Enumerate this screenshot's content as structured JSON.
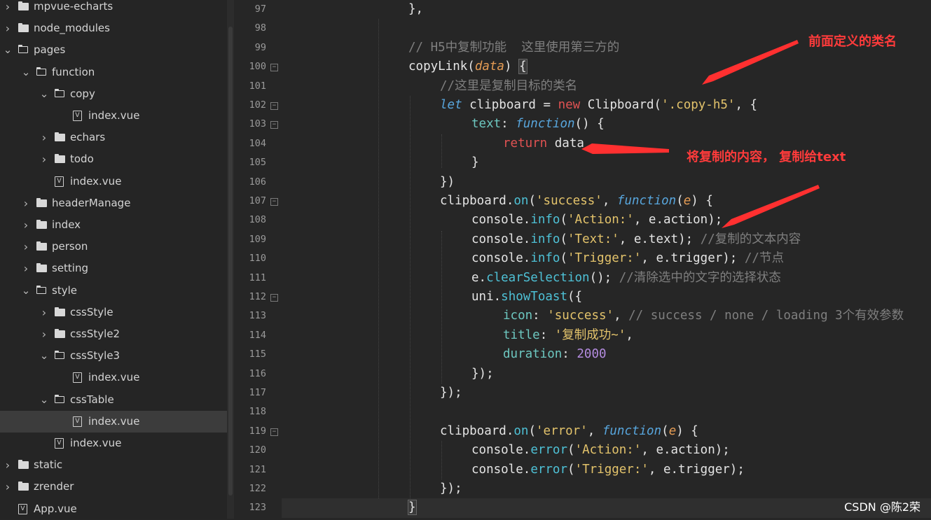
{
  "file_tree": [
    {
      "label": "mpvue-echarts",
      "type": "folder",
      "state": "collapsed",
      "depth": 0
    },
    {
      "label": "node_modules",
      "type": "folder",
      "state": "collapsed",
      "depth": 0
    },
    {
      "label": "pages",
      "type": "folder",
      "state": "expanded",
      "depth": 0
    },
    {
      "label": "function",
      "type": "folder",
      "state": "expanded",
      "depth": 1
    },
    {
      "label": "copy",
      "type": "folder",
      "state": "expanded",
      "depth": 2
    },
    {
      "label": "index.vue",
      "type": "file",
      "depth": 3
    },
    {
      "label": "echars",
      "type": "folder",
      "state": "collapsed",
      "depth": 2
    },
    {
      "label": "todo",
      "type": "folder",
      "state": "collapsed",
      "depth": 2
    },
    {
      "label": "index.vue",
      "type": "file",
      "depth": 2
    },
    {
      "label": "headerManage",
      "type": "folder",
      "state": "collapsed",
      "depth": 1
    },
    {
      "label": "index",
      "type": "folder",
      "state": "collapsed",
      "depth": 1
    },
    {
      "label": "person",
      "type": "folder",
      "state": "collapsed",
      "depth": 1
    },
    {
      "label": "setting",
      "type": "folder",
      "state": "collapsed",
      "depth": 1
    },
    {
      "label": "style",
      "type": "folder",
      "state": "expanded",
      "depth": 1
    },
    {
      "label": "cssStyle",
      "type": "folder",
      "state": "collapsed",
      "depth": 2
    },
    {
      "label": "cssStyle2",
      "type": "folder",
      "state": "collapsed",
      "depth": 2
    },
    {
      "label": "cssStyle3",
      "type": "folder",
      "state": "expanded",
      "depth": 2
    },
    {
      "label": "index.vue",
      "type": "file",
      "depth": 3
    },
    {
      "label": "cssTable",
      "type": "folder",
      "state": "expanded",
      "depth": 2
    },
    {
      "label": "index.vue",
      "type": "file",
      "depth": 3,
      "selected": true
    },
    {
      "label": "index.vue",
      "type": "file",
      "depth": 2
    },
    {
      "label": "static",
      "type": "folder",
      "state": "collapsed",
      "depth": 0
    },
    {
      "label": "zrender",
      "type": "folder",
      "state": "collapsed",
      "depth": 0
    },
    {
      "label": "App.vue",
      "type": "file",
      "depth": 0
    }
  ],
  "code_lines": [
    {
      "n": "97",
      "fold": false,
      "indent": 3,
      "tokens": [
        [
          "},",
          ""
        ]
      ]
    },
    {
      "n": "98",
      "fold": false,
      "indent": 0,
      "tokens": []
    },
    {
      "n": "99",
      "fold": false,
      "indent": 3,
      "tokens": [
        [
          "// H5中复制功能  这里使用第三方的",
          "cm"
        ]
      ]
    },
    {
      "n": "100",
      "fold": true,
      "indent": 3,
      "tokens": [
        [
          "copyLink(",
          ""
        ],
        [
          "data",
          "par"
        ],
        [
          ") ",
          ""
        ],
        [
          "{",
          "brk"
        ]
      ]
    },
    {
      "n": "101",
      "fold": false,
      "indent": 4,
      "tokens": [
        [
          "//这里是复制目标的类名",
          "cm"
        ]
      ]
    },
    {
      "n": "102",
      "fold": true,
      "indent": 4,
      "tokens": [
        [
          "let",
          "kw"
        ],
        [
          " clipboard = ",
          ""
        ],
        [
          "new",
          "new"
        ],
        [
          " Clipboard(",
          ""
        ],
        [
          "'.copy-h5'",
          "str"
        ],
        [
          ", {",
          ""
        ]
      ]
    },
    {
      "n": "103",
      "fold": true,
      "indent": 5,
      "tokens": [
        [
          "text",
          "prop"
        ],
        [
          ": ",
          ""
        ],
        [
          "function",
          "kw"
        ],
        [
          "() {",
          ""
        ]
      ]
    },
    {
      "n": "104",
      "fold": false,
      "indent": 6,
      "tokens": [
        [
          "return",
          "ret"
        ],
        [
          " data",
          ""
        ]
      ]
    },
    {
      "n": "105",
      "fold": false,
      "indent": 5,
      "tokens": [
        [
          "}",
          ""
        ]
      ]
    },
    {
      "n": "106",
      "fold": false,
      "indent": 4,
      "tokens": [
        [
          "})",
          ""
        ]
      ]
    },
    {
      "n": "107",
      "fold": true,
      "indent": 4,
      "tokens": [
        [
          "clipboard",
          ""
        ],
        [
          ".",
          ""
        ],
        [
          "on",
          "fn"
        ],
        [
          "(",
          ""
        ],
        [
          "'success'",
          "str"
        ],
        [
          ", ",
          ""
        ],
        [
          "function",
          "kw"
        ],
        [
          "(",
          ""
        ],
        [
          "e",
          "par"
        ],
        [
          ") {",
          ""
        ]
      ]
    },
    {
      "n": "108",
      "fold": false,
      "indent": 5,
      "tokens": [
        [
          "console",
          ""
        ],
        [
          ".",
          ""
        ],
        [
          "info",
          "fn"
        ],
        [
          "(",
          ""
        ],
        [
          "'Action:'",
          "str"
        ],
        [
          ", e.action);",
          ""
        ]
      ]
    },
    {
      "n": "109",
      "fold": false,
      "indent": 5,
      "tokens": [
        [
          "console",
          ""
        ],
        [
          ".",
          ""
        ],
        [
          "info",
          "fn"
        ],
        [
          "(",
          ""
        ],
        [
          "'Text:'",
          "str"
        ],
        [
          ", e.text); ",
          ""
        ],
        [
          "//复制的文本内容",
          "cm"
        ]
      ]
    },
    {
      "n": "110",
      "fold": false,
      "indent": 5,
      "tokens": [
        [
          "console",
          ""
        ],
        [
          ".",
          ""
        ],
        [
          "info",
          "fn"
        ],
        [
          "(",
          ""
        ],
        [
          "'Trigger:'",
          "str"
        ],
        [
          ", e.trigger); ",
          ""
        ],
        [
          "//节点",
          "cm"
        ]
      ]
    },
    {
      "n": "111",
      "fold": false,
      "indent": 5,
      "tokens": [
        [
          "e.",
          ""
        ],
        [
          "clearSelection",
          "fn"
        ],
        [
          "(); ",
          ""
        ],
        [
          "//清除选中的文字的选择状态",
          "cm"
        ]
      ]
    },
    {
      "n": "112",
      "fold": true,
      "indent": 5,
      "tokens": [
        [
          "uni.",
          ""
        ],
        [
          "showToast",
          "fn"
        ],
        [
          "({",
          ""
        ]
      ]
    },
    {
      "n": "113",
      "fold": false,
      "indent": 6,
      "tokens": [
        [
          "icon",
          "prop"
        ],
        [
          ": ",
          ""
        ],
        [
          "'success'",
          "str"
        ],
        [
          ", ",
          ""
        ],
        [
          "// success / none / loading 3个有效参数",
          "cm"
        ]
      ]
    },
    {
      "n": "114",
      "fold": false,
      "indent": 6,
      "tokens": [
        [
          "title",
          "prop"
        ],
        [
          ": ",
          ""
        ],
        [
          "'复制成功~'",
          "str"
        ],
        [
          ",",
          ""
        ]
      ]
    },
    {
      "n": "115",
      "fold": false,
      "indent": 6,
      "tokens": [
        [
          "duration",
          "prop"
        ],
        [
          ": ",
          ""
        ],
        [
          "2000",
          "num"
        ]
      ]
    },
    {
      "n": "116",
      "fold": false,
      "indent": 5,
      "tokens": [
        [
          "});",
          ""
        ]
      ]
    },
    {
      "n": "117",
      "fold": false,
      "indent": 4,
      "tokens": [
        [
          "});",
          ""
        ]
      ]
    },
    {
      "n": "118",
      "fold": false,
      "indent": 0,
      "tokens": []
    },
    {
      "n": "119",
      "fold": true,
      "indent": 4,
      "tokens": [
        [
          "clipboard",
          ""
        ],
        [
          ".",
          ""
        ],
        [
          "on",
          "fn"
        ],
        [
          "(",
          ""
        ],
        [
          "'error'",
          "str"
        ],
        [
          ", ",
          ""
        ],
        [
          "function",
          "kw"
        ],
        [
          "(",
          ""
        ],
        [
          "e",
          "par"
        ],
        [
          ") {",
          ""
        ]
      ]
    },
    {
      "n": "120",
      "fold": false,
      "indent": 5,
      "tokens": [
        [
          "console",
          ""
        ],
        [
          ".",
          ""
        ],
        [
          "error",
          "fn"
        ],
        [
          "(",
          ""
        ],
        [
          "'Action:'",
          "str"
        ],
        [
          ", e.action);",
          ""
        ]
      ]
    },
    {
      "n": "121",
      "fold": false,
      "indent": 5,
      "tokens": [
        [
          "console",
          ""
        ],
        [
          ".",
          ""
        ],
        [
          "error",
          "fn"
        ],
        [
          "(",
          ""
        ],
        [
          "'Trigger:'",
          "str"
        ],
        [
          ", e.trigger);",
          ""
        ]
      ]
    },
    {
      "n": "122",
      "fold": false,
      "indent": 4,
      "tokens": [
        [
          "});",
          ""
        ]
      ]
    },
    {
      "n": "123",
      "fold": false,
      "indent": 3,
      "tokens": [
        [
          "}",
          "brk"
        ]
      ]
    }
  ],
  "annotations": {
    "class_name": "前面定义的类名",
    "copy_to_text": "将复制的内容， 复制给text"
  },
  "watermark": "CSDN @陈2荣",
  "colors": {
    "annotation": "#ff3b3b",
    "comment": "#7f7f7f",
    "keyword": "#58a6dd",
    "string": "#e3c36b",
    "number": "#b48ce0"
  }
}
